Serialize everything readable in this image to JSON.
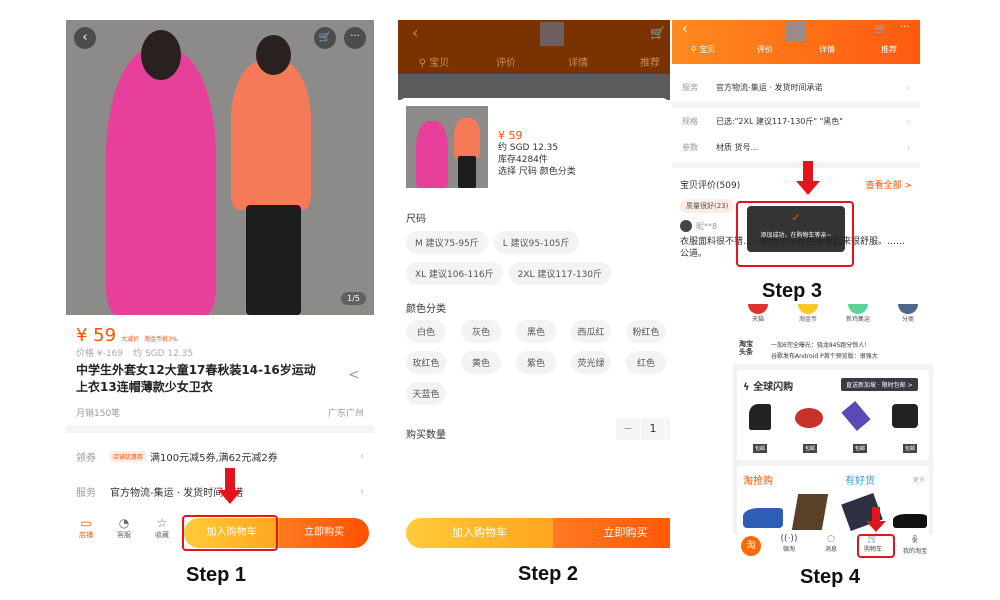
{
  "steps": [
    "Step 1",
    "Step 2",
    "Step 3",
    "Step 4"
  ],
  "colors": {
    "accent": "#ff5000",
    "cart_btn": "#ffb300",
    "highlight": "#e3141b"
  },
  "step1": {
    "image_counter": "1/5",
    "icons": [
      "back-icon",
      "cart-icon",
      "more-icon",
      "share-icon"
    ],
    "price": "¥ 59",
    "tag1": "大减价",
    "tag2": "淘金币抵3%",
    "orig_price": "价格 ¥-169",
    "sgd": "约 SGD 12.35",
    "title_line1": "中学生外套女12大童17春秋装14-16岁运动",
    "title_line2": "上衣13连帽薄款少女卫衣",
    "monthly_sales": "月销150笔",
    "location": "广东广州",
    "coupon_key": "领券",
    "coupon_tag": "店铺优惠券",
    "coupon_text": "满100元减5券,满62元减2券",
    "service_key": "服务",
    "service_text": "官方物流-集运 · 发货时间承诺",
    "bottom": {
      "shop": "店铺",
      "service": "客服",
      "favorite": "收藏",
      "add_cart": "加入购物车",
      "buy_now": "立即购买"
    }
  },
  "step2": {
    "nav": [
      "宝贝",
      "评价",
      "详情",
      "推荐"
    ],
    "price": "¥ 59",
    "sgd": "约 SGD 12.35",
    "stock": "库存4284件",
    "select": "选择  尺码 颜色分类",
    "size_label": "尺码",
    "sizes": [
      "M 建议75-95斤",
      "L 建议95-105斤",
      "XL 建议106-116斤",
      "2XL 建议117-130斤"
    ],
    "color_label": "颜色分类",
    "colors": [
      "白色",
      "灰色",
      "黑色",
      "西瓜红",
      "粉红色",
      "玫红色",
      "黄色",
      "紫色",
      "荧光绿",
      "红色",
      "天蓝色"
    ],
    "qty_label": "购买数量",
    "qty": "1",
    "minus": "−",
    "plus": "+",
    "add_cart": "加入购物车",
    "buy_now": "立即购买"
  },
  "step3": {
    "nav": [
      "宝贝",
      "评价",
      "详情",
      "推荐"
    ],
    "rows": [
      {
        "k": "服务",
        "v": "官方物流-集运 · 发货时间承诺"
      },
      {
        "k": "规格",
        "v": "已选:\"2XL 建议117-130斤\" \"黑色\""
      },
      {
        "k": "参数",
        "v": "材质 货号..."
      }
    ],
    "reviews_title": "宝贝评价(509)",
    "view_all": "查看全部 >",
    "review_tag": "质量很好(23)",
    "reviewer": "昵**8",
    "review_text": "衣服面料很不错……颜色也没有色差看起来很舒服。……公道。",
    "toast": "添加成功，在购物车等亲~"
  },
  "step4": {
    "icons": [
      "天猫",
      "淘金币",
      "新鸡集运",
      "分类"
    ],
    "headline_logo": "淘宝头条",
    "headlines": [
      "一加6完全曝光：骁龙845跑分惊人！",
      "谷歌发布Android P首个预览版：很强大"
    ],
    "flash_title": "全球闪购",
    "flash_badge": "直送新加坡 · 限时包邮 >",
    "price_tag": "包邮",
    "tao_qiang": "淘抢购",
    "you_hao": "有好货",
    "more": "更多",
    "tabs": [
      "淘",
      "微淘",
      "消息",
      "购物车",
      "我的淘宝"
    ]
  }
}
